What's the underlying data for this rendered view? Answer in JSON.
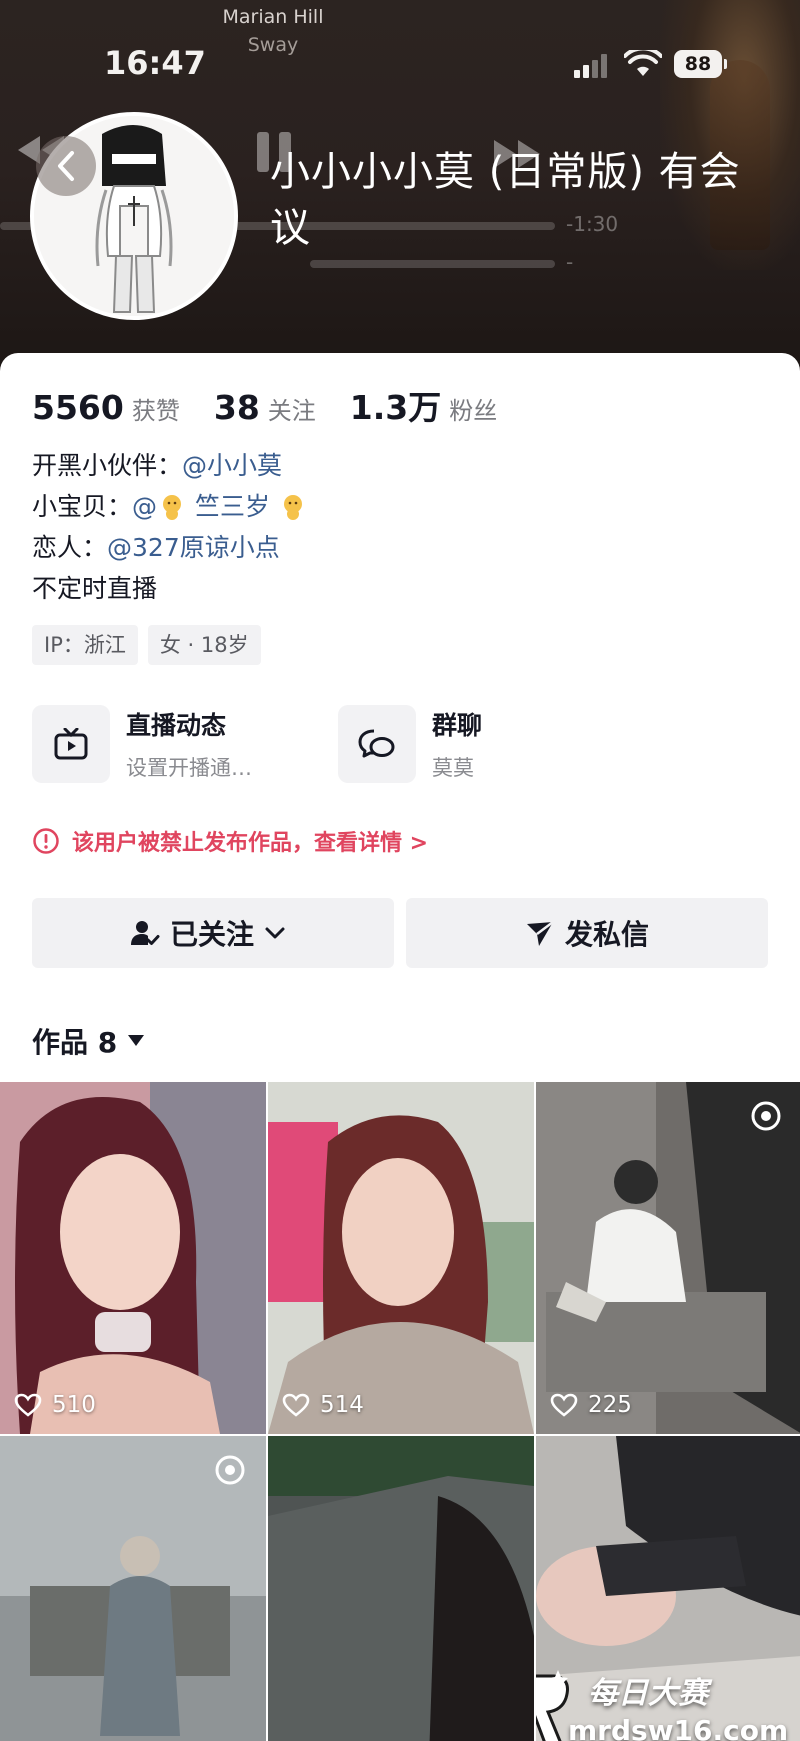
{
  "status_bar": {
    "time": "16:47",
    "battery": "88",
    "now_playing_title": "Marian Hill",
    "now_playing_artist": "Sway"
  },
  "player_overlay": {
    "time_remaining": "-1:30",
    "time_remaining_2": "-"
  },
  "profile": {
    "nickname": "小小小小莫 (日常版) 有会议"
  },
  "stats": {
    "likes_value": "5560",
    "likes_label": "获赞",
    "following_value": "38",
    "following_label": "关注",
    "followers_value": "1.3万",
    "followers_label": "粉丝"
  },
  "bio": {
    "line1_prefix": "开黑小伙伴：",
    "line1_mention": "@小小莫",
    "line2_prefix": "小宝贝：",
    "line2_mention_at": "@",
    "line2_mention_name": " 竺三岁 ",
    "line3_prefix": "恋人：",
    "line3_mention": "@327原谅小点",
    "line4": "不定时直播"
  },
  "tags": [
    "IP：浙江",
    "女 · 18岁"
  ],
  "features": {
    "live": {
      "title": "直播动态",
      "subtitle": "设置开播通…"
    },
    "group": {
      "title": "群聊",
      "subtitle": "莫莫"
    }
  },
  "warning": {
    "text": "该用户被禁止发布作品，查看详情 >"
  },
  "actions": {
    "following_label": "已关注",
    "message_label": "发私信"
  },
  "works": {
    "label": "作品 8",
    "items": [
      {
        "likes": "510"
      },
      {
        "likes": "514"
      },
      {
        "likes": "225"
      },
      {
        "likes": ""
      },
      {
        "likes": ""
      },
      {
        "likes": ""
      }
    ]
  },
  "watermark": {
    "title": "每日大赛",
    "url": "mrdsw16.com"
  },
  "colors": {
    "header_bg": "#2a211f",
    "warning_red": "#e0455f",
    "mention_blue": "#3a5d8f",
    "button_bg": "#f1f1f3"
  }
}
